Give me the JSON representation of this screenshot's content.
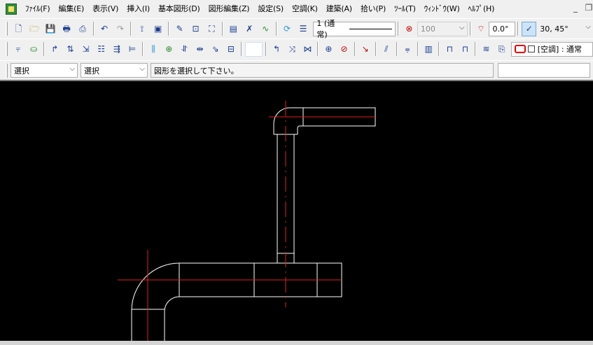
{
  "menubar": {
    "items": [
      "ﾌｧｲﾙ(F)",
      "編集(E)",
      "表示(V)",
      "挿入(I)",
      "基本図形(D)",
      "図形編集(Z)",
      "設定(S)",
      "空調(K)",
      "建築(A)",
      "拾い(P)",
      "ﾂｰﾙ(T)",
      "ｳｨﾝﾄﾞｳ(W)",
      "ﾍﾙﾌﾟ(H)"
    ]
  },
  "toolbar1": {
    "linetype_label": "1 (通常)",
    "scale_value": "100",
    "angle_value": "0.0°",
    "snap_angles": "30, 45°"
  },
  "toolbar2": {
    "layer_label": "[空調] : 通常"
  },
  "toolbar3": {
    "select_combo_1": "選択",
    "select_combo_2": "選択",
    "prompt": "図形を選択して下さい。",
    "command_input": ""
  },
  "icons": {
    "toolbar1": [
      "new-file-icon",
      "open-folder-icon",
      "save-icon",
      "print-preview-icon",
      "print-icon",
      "undo-icon",
      "redo-icon",
      "insert-text-icon",
      "insert-image-icon",
      "measure-icon",
      "zoom-window-icon",
      "zoom-fit-icon",
      "text-tool-icon",
      "spell-icon",
      "curve-icon",
      "refresh-icon",
      "properties-icon"
    ],
    "toolbar2": [
      "duct-tool-icon",
      "fitting-tool-icon",
      "elbow-icon",
      "branch-icon",
      "reducer-icon",
      "damper-icon",
      "flange-icon",
      "pipe-icon",
      "valve-icon",
      "fan-icon",
      "coil-icon",
      "cap-icon",
      "outlet-icon",
      "inlet-icon",
      "crosshair-icon",
      "hatch-icon",
      "arrow-icon",
      "slash-icon",
      "dimension-icon",
      "table-icon",
      "frame-icon",
      "frame2-icon",
      "layers-icon",
      "layer-manage-icon"
    ]
  },
  "colors": {
    "canvas_bg": "#000000",
    "geometry": "#ffffff",
    "centerline": "#e02020"
  }
}
